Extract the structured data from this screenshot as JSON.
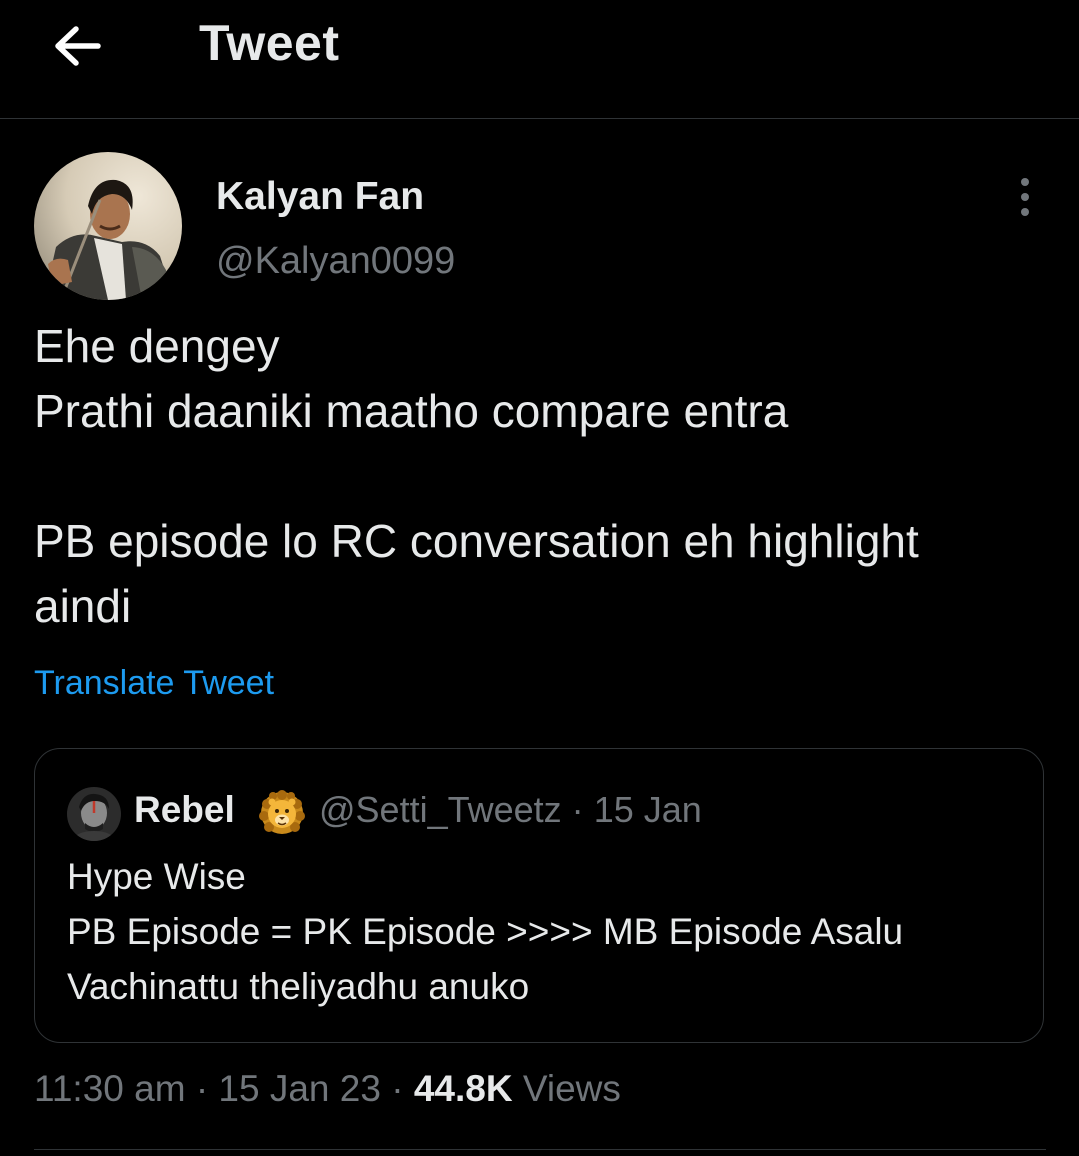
{
  "header": {
    "title": "Tweet",
    "back_icon": "arrow-left-icon"
  },
  "tweet": {
    "author": {
      "display_name": "Kalyan Fan",
      "handle": "@Kalyan0099"
    },
    "more_icon": "more-vertical-icon",
    "text_lines": [
      "Ehe dengey",
      "Prathi daaniki maatho compare entra",
      "",
      "PB episode lo RC conversation eh highlight",
      "aindi"
    ],
    "translate_label": "Translate Tweet",
    "quoted": {
      "display_name": "Rebel",
      "emoji": "🦁",
      "handle": "@Setti_Tweetz",
      "separator": "·",
      "date": "15 Jan",
      "text_lines": [
        "Hype Wise",
        "PB Episode = PK Episode >>>> MB Episode Asalu",
        "Vachinattu theliyadhu anuko"
      ]
    },
    "meta": {
      "time": "11:30 am",
      "sep1": "·",
      "date": "15 Jan 23",
      "sep2": "·",
      "views_count": "44.8K",
      "views_label": "Views"
    }
  },
  "colors": {
    "background": "#000000",
    "text_primary": "#e7e9ea",
    "text_secondary": "#71767b",
    "link": "#1d9bf0",
    "border": "#2f3336"
  }
}
